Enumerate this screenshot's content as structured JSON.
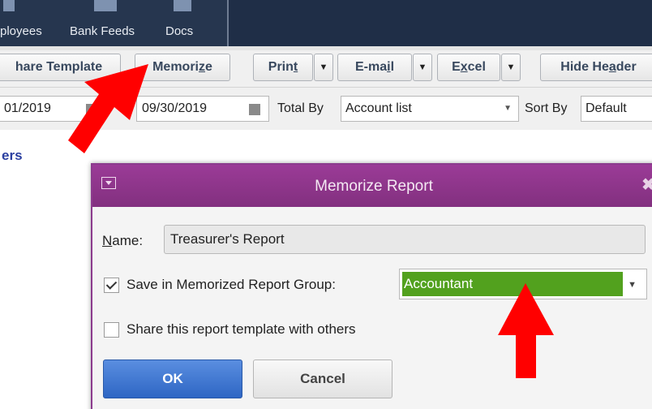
{
  "topnav": {
    "items": [
      {
        "label": "ployees",
        "icon": "employees-icon"
      },
      {
        "label": "Bank Feeds",
        "icon": "bank-feeds-icon"
      },
      {
        "label": "Docs",
        "icon": "docs-icon"
      }
    ]
  },
  "toolbar": {
    "share_template": "hare Template",
    "memorize_pre": "Memori",
    "memorize_u": "z",
    "memorize_post": "e",
    "print_pre": "Prin",
    "print_u": "t",
    "email_pre": "E-ma",
    "email_u": "i",
    "email_post": "l",
    "excel_pre": "E",
    "excel_u": "x",
    "excel_post": "cel",
    "hide_header_pre": "Hide He",
    "hide_header_u": "a",
    "hide_header_post": "der"
  },
  "filters": {
    "from_date": "01/2019",
    "to_date": "09/30/2019",
    "total_by_label": "Total By",
    "total_by_value": "Account list",
    "sort_by_label": "Sort By",
    "sort_by_value": "Default"
  },
  "report": {
    "heading": "ers"
  },
  "dialog": {
    "title": "Memorize Report",
    "close_glyph": "✖",
    "name_label_u": "N",
    "name_label_rest": "ame:",
    "name_value": "Treasurer's Report",
    "save_group_label": "Save in Memorized Report Group:",
    "save_group_checked": true,
    "group_value": "Accountant",
    "share_label": "Share this report template with others",
    "share_checked": false,
    "ok_label": "OK",
    "cancel_label": "Cancel"
  },
  "colors": {
    "dialog_title_bar": "#8c3b8e",
    "group_highlight": "#52a11e",
    "ok_button": "#3a72d0",
    "annotation_arrow": "#ff0000",
    "top_bar": "#1f2e47"
  }
}
